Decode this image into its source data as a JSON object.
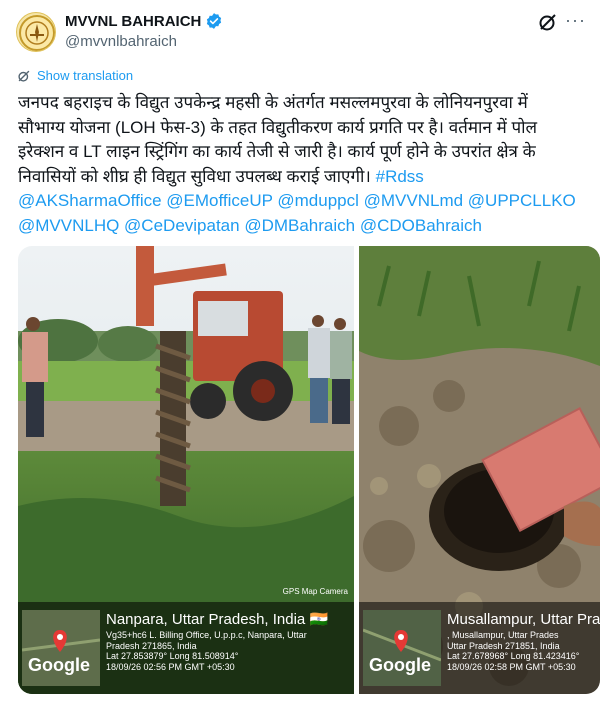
{
  "account": {
    "name": "MVVNL BAHRAICH",
    "handle": "@mvvnlbahraich"
  },
  "actions": {
    "more": "···"
  },
  "translate": {
    "label": "Show translation"
  },
  "tweet": {
    "lines": [
      "जनपद बहराइच के विद्युत उपकेन्द्र महसी के अंतर्गत मसल्लमपुरवा के लोनियनपुरवा में",
      "सौभाग्य योजना (LOH फेस-3) के तहत विद्युतीकरण कार्य प्रगति पर है। वर्तमान में पोल",
      "इरेक्शन व LT लाइन स्ट्रिंगिंग का कार्य तेजी से जारी है। कार्य पूर्ण होने के उपरांत क्षेत्र के",
      "निवासियों को शीघ्र ही विद्युत सुविधा उपलब्ध कराई जाएगी।"
    ],
    "hashtag": "#Rdss",
    "mentions_line1": "@AKSharmaOffice @EMofficeUP @mduppcl @MVVNLmd @UPPCLLKO",
    "mentions_line2": "@MVVNLHQ @CeDevipatan @DMBahraich @CDOBahraich"
  },
  "photos": [
    {
      "camera_label": "GPS Map Camera",
      "title": "Nanpara, Uttar Pradesh, India 🇮🇳",
      "address1": "Vg35+hc6 L. Billing Office, U.p.p.c, Nanpara, Uttar",
      "address2": "Pradesh 271865, India",
      "coords": "Lat 27.853879° Long 81.508914°",
      "datetime": "18/09/26 02:56 PM GMT +05:30",
      "map_brand": "Google"
    },
    {
      "title": "Musallampur, Uttar Prad",
      "address1": ", Musallampur, Uttar Prades",
      "address2": "Uttar Pradesh 271851, India",
      "coords": "Lat 27.678968° Long 81.423416°",
      "datetime": "18/09/26 02:58 PM GMT +05:30",
      "map_brand": "Google"
    }
  ],
  "colors": {
    "link": "#1d9bf0",
    "verified": "#1d9bf0",
    "text": "#0f1419",
    "muted": "#536471"
  }
}
